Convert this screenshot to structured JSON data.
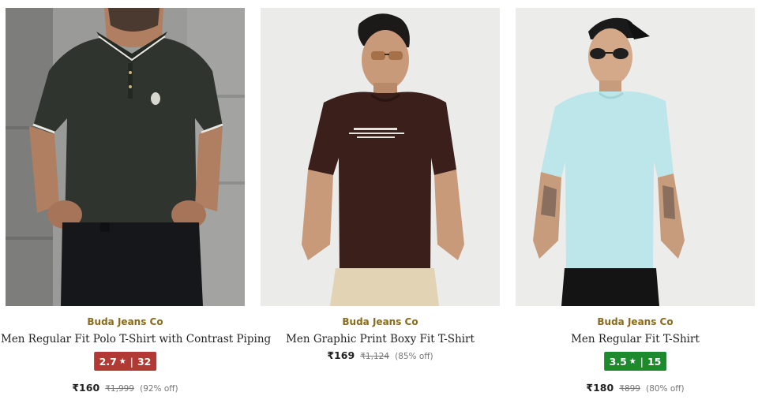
{
  "products": [
    {
      "brand": "Buda Jeans Co",
      "title": "Men Regular Fit Polo T-Shirt with Contrast Piping",
      "rating": "2.7",
      "rating_count": "32",
      "price": "₹160",
      "mrp": "₹1,999",
      "discount": "(92% off)"
    },
    {
      "brand": "Buda Jeans Co",
      "title": "Men Graphic Print Boxy Fit T-Shirt",
      "price": "₹169",
      "mrp": "₹1,124",
      "discount": "(85% off)"
    },
    {
      "brand": "Buda Jeans Co",
      "title": "Men Regular Fit T-Shirt",
      "rating": "3.5",
      "rating_count": "15",
      "price": "₹180",
      "mrp": "₹899",
      "discount": "(80% off)"
    }
  ],
  "icons": {
    "rating_star": "star-icon"
  },
  "colors": {
    "brand_text": "#8a6a1c",
    "rating_low": "#b23a35",
    "rating_good": "#1e8a2e"
  }
}
